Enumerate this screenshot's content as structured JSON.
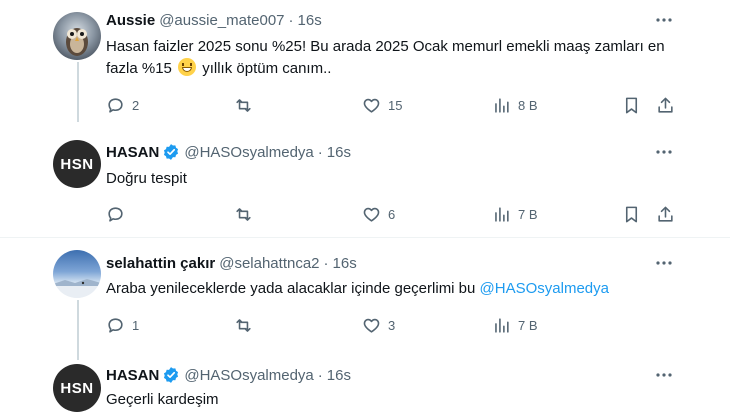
{
  "tweets": [
    {
      "name": "Aussie",
      "handle": "@aussie_mate007",
      "time": "16s",
      "verified": false,
      "avatar": "owl-avatar",
      "text_before": "Hasan faizler 2025 sonu %25! Bu arada 2025 Ocak memurl emekli maaş zamları en fazla %15",
      "emoji": "grinning-face",
      "text_after": " yıllık öptüm canım..",
      "replies": "2",
      "retweets": "",
      "likes": "15",
      "views": "8 B"
    },
    {
      "name": "HASAN",
      "handle": "@HASOsyalmedya",
      "time": "16s",
      "verified": true,
      "avatar_text": "HSN",
      "text": "Doğru tespit",
      "replies": "",
      "retweets": "",
      "likes": "6",
      "views": "7 B"
    },
    {
      "name": "selahattin çakır",
      "handle": "@selahattnca2",
      "time": "16s",
      "verified": false,
      "avatar": "sky-landscape-avatar",
      "text_before": "Araba yenileceklerde yada alacaklar içinde geçerlimi bu ",
      "mention": "@HASOsyalmedya",
      "replies": "1",
      "retweets": "",
      "likes": "3",
      "views": "7 B"
    },
    {
      "name": "HASAN",
      "handle": "@HASOsyalmedya",
      "time": "16s",
      "verified": true,
      "avatar_text": "HSN",
      "text": "Geçerli kardeşim"
    }
  ],
  "colors": {
    "text": "#0f1419",
    "secondary": "#536471",
    "accent": "#1d9bf0",
    "divider": "#eff3f4",
    "thread": "#cfd9de"
  }
}
